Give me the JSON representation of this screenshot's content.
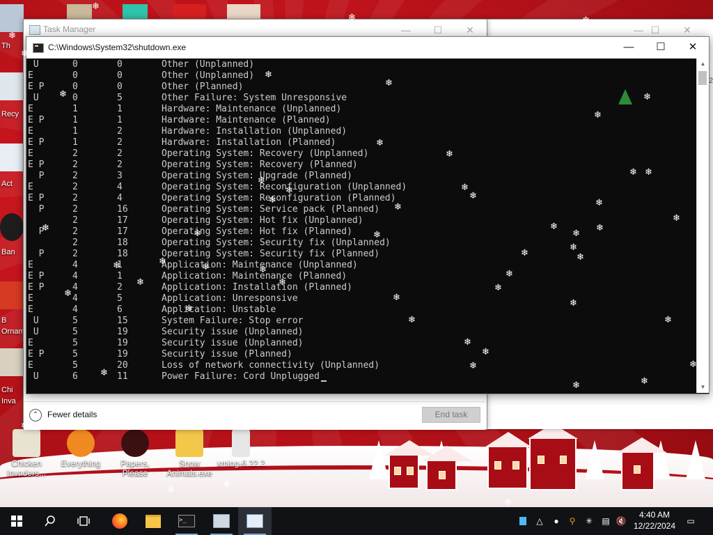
{
  "desktop": {
    "icons": [
      {
        "name": "chicken-invaders",
        "label": "Chicken Invaders...",
        "color": "#e8e2d0"
      },
      {
        "name": "everything",
        "label": "Everything",
        "color": "#f08a20"
      },
      {
        "name": "papers-please",
        "label": "Papers, Please",
        "color": "#3a1010"
      },
      {
        "name": "snow-animals",
        "label": "Snow Animals.exe",
        "color": "#f2c74a"
      },
      {
        "name": "xming",
        "label": "xming-6.22.2",
        "color": "#e6e6e6"
      }
    ],
    "edge_labels": [
      "Th",
      "Recy",
      "Act",
      "Ban",
      "B",
      "Ornam",
      "Chi",
      "Inva"
    ]
  },
  "task_manager": {
    "title": "Task Manager",
    "fewer_details": "Fewer details",
    "end_task": "End task"
  },
  "background_window": {
    "side_number": "2"
  },
  "console": {
    "title": "C:\\Windows\\System32\\shutdown.exe",
    "rows": [
      {
        "flag": " U",
        "major": "0",
        "minor": "0",
        "title": "Other (Unplanned)"
      },
      {
        "flag": "E",
        "major": "0",
        "minor": "0",
        "title": "Other (Unplanned)"
      },
      {
        "flag": "E P",
        "major": "0",
        "minor": "0",
        "title": "Other (Planned)"
      },
      {
        "flag": " U",
        "major": "0",
        "minor": "5",
        "title": "Other Failure: System Unresponsive"
      },
      {
        "flag": "E",
        "major": "1",
        "minor": "1",
        "title": "Hardware: Maintenance (Unplanned)"
      },
      {
        "flag": "E P",
        "major": "1",
        "minor": "1",
        "title": "Hardware: Maintenance (Planned)"
      },
      {
        "flag": "E",
        "major": "1",
        "minor": "2",
        "title": "Hardware: Installation (Unplanned)"
      },
      {
        "flag": "E P",
        "major": "1",
        "minor": "2",
        "title": "Hardware: Installation (Planned)"
      },
      {
        "flag": "E",
        "major": "2",
        "minor": "2",
        "title": "Operating System: Recovery (Unplanned)"
      },
      {
        "flag": "E P",
        "major": "2",
        "minor": "2",
        "title": "Operating System: Recovery (Planned)"
      },
      {
        "flag": "  P",
        "major": "2",
        "minor": "3",
        "title": "Operating System: Upgrade (Planned)"
      },
      {
        "flag": "E",
        "major": "2",
        "minor": "4",
        "title": "Operating System: Reconfiguration (Unplanned)"
      },
      {
        "flag": "E P",
        "major": "2",
        "minor": "4",
        "title": "Operating System: Reconfiguration (Planned)"
      },
      {
        "flag": "  P",
        "major": "2",
        "minor": "16",
        "title": "Operating System: Service pack (Planned)"
      },
      {
        "flag": "",
        "major": "2",
        "minor": "17",
        "title": "Operating System: Hot fix (Unplanned)"
      },
      {
        "flag": "  P",
        "major": "2",
        "minor": "17",
        "title": "Operating System: Hot fix (Planned)"
      },
      {
        "flag": "",
        "major": "2",
        "minor": "18",
        "title": "Operating System: Security fix (Unplanned)"
      },
      {
        "flag": "  P",
        "major": "2",
        "minor": "18",
        "title": "Operating System: Security fix (Planned)"
      },
      {
        "flag": "E",
        "major": "4",
        "minor": "1",
        "title": "Application: Maintenance (Unplanned)"
      },
      {
        "flag": "E P",
        "major": "4",
        "minor": "1",
        "title": "Application: Maintenance (Planned)"
      },
      {
        "flag": "E P",
        "major": "4",
        "minor": "2",
        "title": "Application: Installation (Planned)"
      },
      {
        "flag": "E",
        "major": "4",
        "minor": "5",
        "title": "Application: Unresponsive"
      },
      {
        "flag": "E",
        "major": "4",
        "minor": "6",
        "title": "Application: Unstable"
      },
      {
        "flag": " U",
        "major": "5",
        "minor": "15",
        "title": "System Failure: Stop error"
      },
      {
        "flag": " U",
        "major": "5",
        "minor": "19",
        "title": "Security issue (Unplanned)"
      },
      {
        "flag": "E",
        "major": "5",
        "minor": "19",
        "title": "Security issue (Unplanned)"
      },
      {
        "flag": "E P",
        "major": "5",
        "minor": "19",
        "title": "Security issue (Planned)"
      },
      {
        "flag": "E",
        "major": "5",
        "minor": "20",
        "title": "Loss of network connectivity (Unplanned)"
      },
      {
        "flag": " U",
        "major": "6",
        "minor": "11",
        "title": "Power Failure: Cord Unplugged"
      }
    ]
  },
  "taskbar": {
    "items": [
      {
        "name": "start-button",
        "icon": "windows-logo"
      },
      {
        "name": "search-button",
        "icon": "search-icon"
      },
      {
        "name": "task-view-button",
        "icon": "task-view-icon"
      },
      {
        "name": "firefox",
        "icon": "firefox-icon"
      },
      {
        "name": "file-explorer",
        "icon": "folder-icon"
      },
      {
        "name": "command-prompt",
        "icon": "terminal-icon"
      },
      {
        "name": "control-panel",
        "icon": "control-panel-icon"
      },
      {
        "name": "task-manager",
        "icon": "task-manager-icon"
      }
    ],
    "clock": {
      "time": "4:40 AM",
      "date": "12/22/2024"
    }
  },
  "colors": {
    "console_bg": "#0c0c0c",
    "console_text": "#cccccc",
    "wallpaper_red": "#c5141c",
    "taskbar": "#101216"
  }
}
